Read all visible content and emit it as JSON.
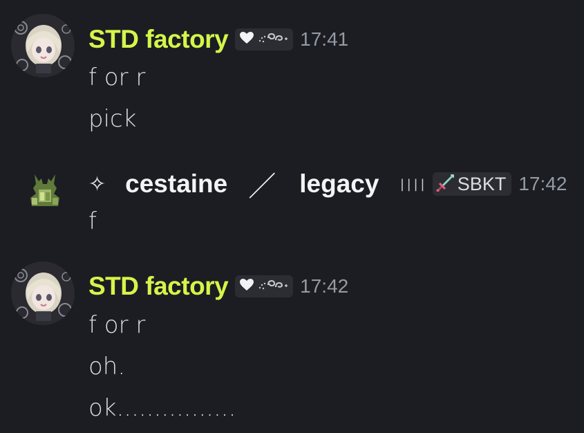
{
  "messages": [
    {
      "author": "STD factory",
      "author_color": "#d4f54a",
      "badge_icons": [
        "heart-icon",
        "swirl-icon"
      ],
      "time": "17:41",
      "lines": [
        "f or r",
        "pick"
      ]
    },
    {
      "author_prefix": "✧",
      "author_part1": "cestaine",
      "author_separator": "／",
      "author_part2": "legacy",
      "author_bars": "||||",
      "badge_icons": [
        "sword-icon"
      ],
      "badge_label": "SBKT",
      "time": "17:42",
      "lines": [
        "f"
      ]
    },
    {
      "author": "STD factory",
      "author_color": "#d4f54a",
      "badge_icons": [
        "heart-icon",
        "swirl-icon"
      ],
      "time": "17:42",
      "lines": [
        "f or r",
        "oh.",
        "ok................"
      ]
    }
  ]
}
